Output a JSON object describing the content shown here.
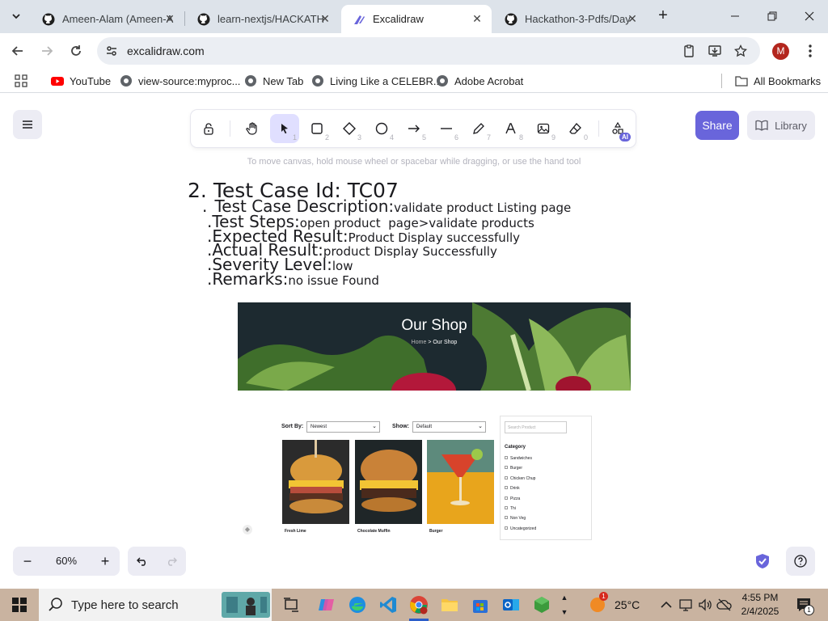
{
  "tabs": [
    {
      "title": "Ameen-Alam (Ameen-A",
      "icon": "github-icon"
    },
    {
      "title": "learn-nextjs/HACKATH",
      "icon": "github-icon"
    },
    {
      "title": "Excalidraw",
      "icon": "excalidraw-icon",
      "active": true
    },
    {
      "title": "Hackathon-3-Pdfs/Day",
      "icon": "github-icon"
    }
  ],
  "address": {
    "url": "excalidraw.com"
  },
  "profile": {
    "initial": "M"
  },
  "bookmarks": [
    {
      "label": "YouTube",
      "icon": "youtube-icon"
    },
    {
      "label": "view-source:myproc...",
      "icon": "globe-icon"
    },
    {
      "label": "New Tab",
      "icon": "globe-icon"
    },
    {
      "label": "Living Like a CELEBR...",
      "icon": "globe-icon"
    },
    {
      "label": "Adobe Acrobat",
      "icon": "globe-icon"
    }
  ],
  "all_bookmarks": "All Bookmarks",
  "excalidraw": {
    "share": "Share",
    "library": "Library",
    "ai_badge": "AI",
    "hint": "To move canvas, hold mouse wheel or spacebar while dragging, or use the hand tool",
    "tool_numbers": [
      "1",
      "2",
      "3",
      "4",
      "5",
      "6",
      "7",
      "8",
      "9",
      "0"
    ],
    "zoom": "60%"
  },
  "doc": {
    "heading_num": "2.",
    "heading": "Test Case Id:",
    "heading_val": "TC07",
    "rows": [
      {
        "bullet": ".",
        "label": "Test Case Description:",
        "value": "validate product Listing page"
      },
      {
        "bullet": ".",
        "label": "Test Steps:",
        "value": "open product  page>validate products"
      },
      {
        "bullet": ".",
        "label": "Expected Result:",
        "value": "Product Display successfully"
      },
      {
        "bullet": ".",
        "label": "Actual Result:",
        "value": "product Display Successfully"
      },
      {
        "bullet": ".",
        "label": "Severity Level:",
        "value": "low"
      },
      {
        "bullet": ".",
        "label": "Remarks:",
        "value": "no issue Found"
      }
    ]
  },
  "hero": {
    "title": "Our Shop",
    "crumb_home": "Home",
    "crumb_sep": ">",
    "crumb_current": "Our Shop"
  },
  "shop": {
    "sort_label": "Sort By:",
    "sort_value": "Newest",
    "show_label": "Show:",
    "show_value": "Default",
    "search_placeholder": "Search Product",
    "category_title": "Category",
    "categories": [
      "Sandwiches",
      "Burger",
      "Chicken Chup",
      "Drink",
      "Pizza",
      "Thi",
      "Non Veg",
      "Uncategorized"
    ],
    "products": [
      {
        "name": "Fresh Lime"
      },
      {
        "name": "Chocolate Muffin"
      },
      {
        "name": "Burger"
      }
    ]
  },
  "taskbar": {
    "search_placeholder": "Type here to search",
    "temperature": "25°C",
    "time": "4:55 PM",
    "date": "2/4/2025",
    "notification_count": "1"
  },
  "colors": {
    "accent": "#6965db",
    "tab_strip": "#dde3ea",
    "selected_tool": "#e0dfff"
  }
}
